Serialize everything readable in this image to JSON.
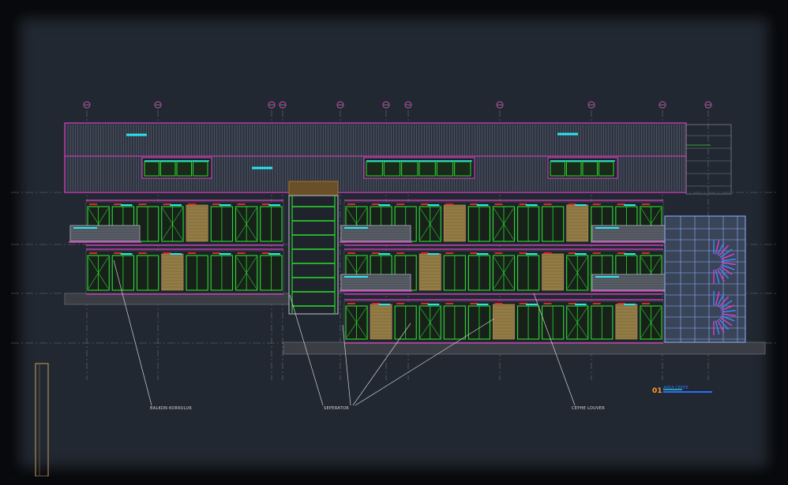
{
  "drawing": {
    "annotations": {
      "balcony": "BALKON KORKULUK",
      "separator": "SEPERATOR",
      "louver": "CEPHE LOUVER"
    },
    "view_number": "01",
    "view_title": "ARKA CEPHE"
  },
  "colors": {
    "background": "#222831",
    "magenta": "#e040c8",
    "green": "#2bdc2b",
    "cyan": "#28e6f0",
    "red": "#e02828",
    "grey": "#8a8e96",
    "wood": "#8a7440",
    "blue": "#8ab4ff"
  }
}
